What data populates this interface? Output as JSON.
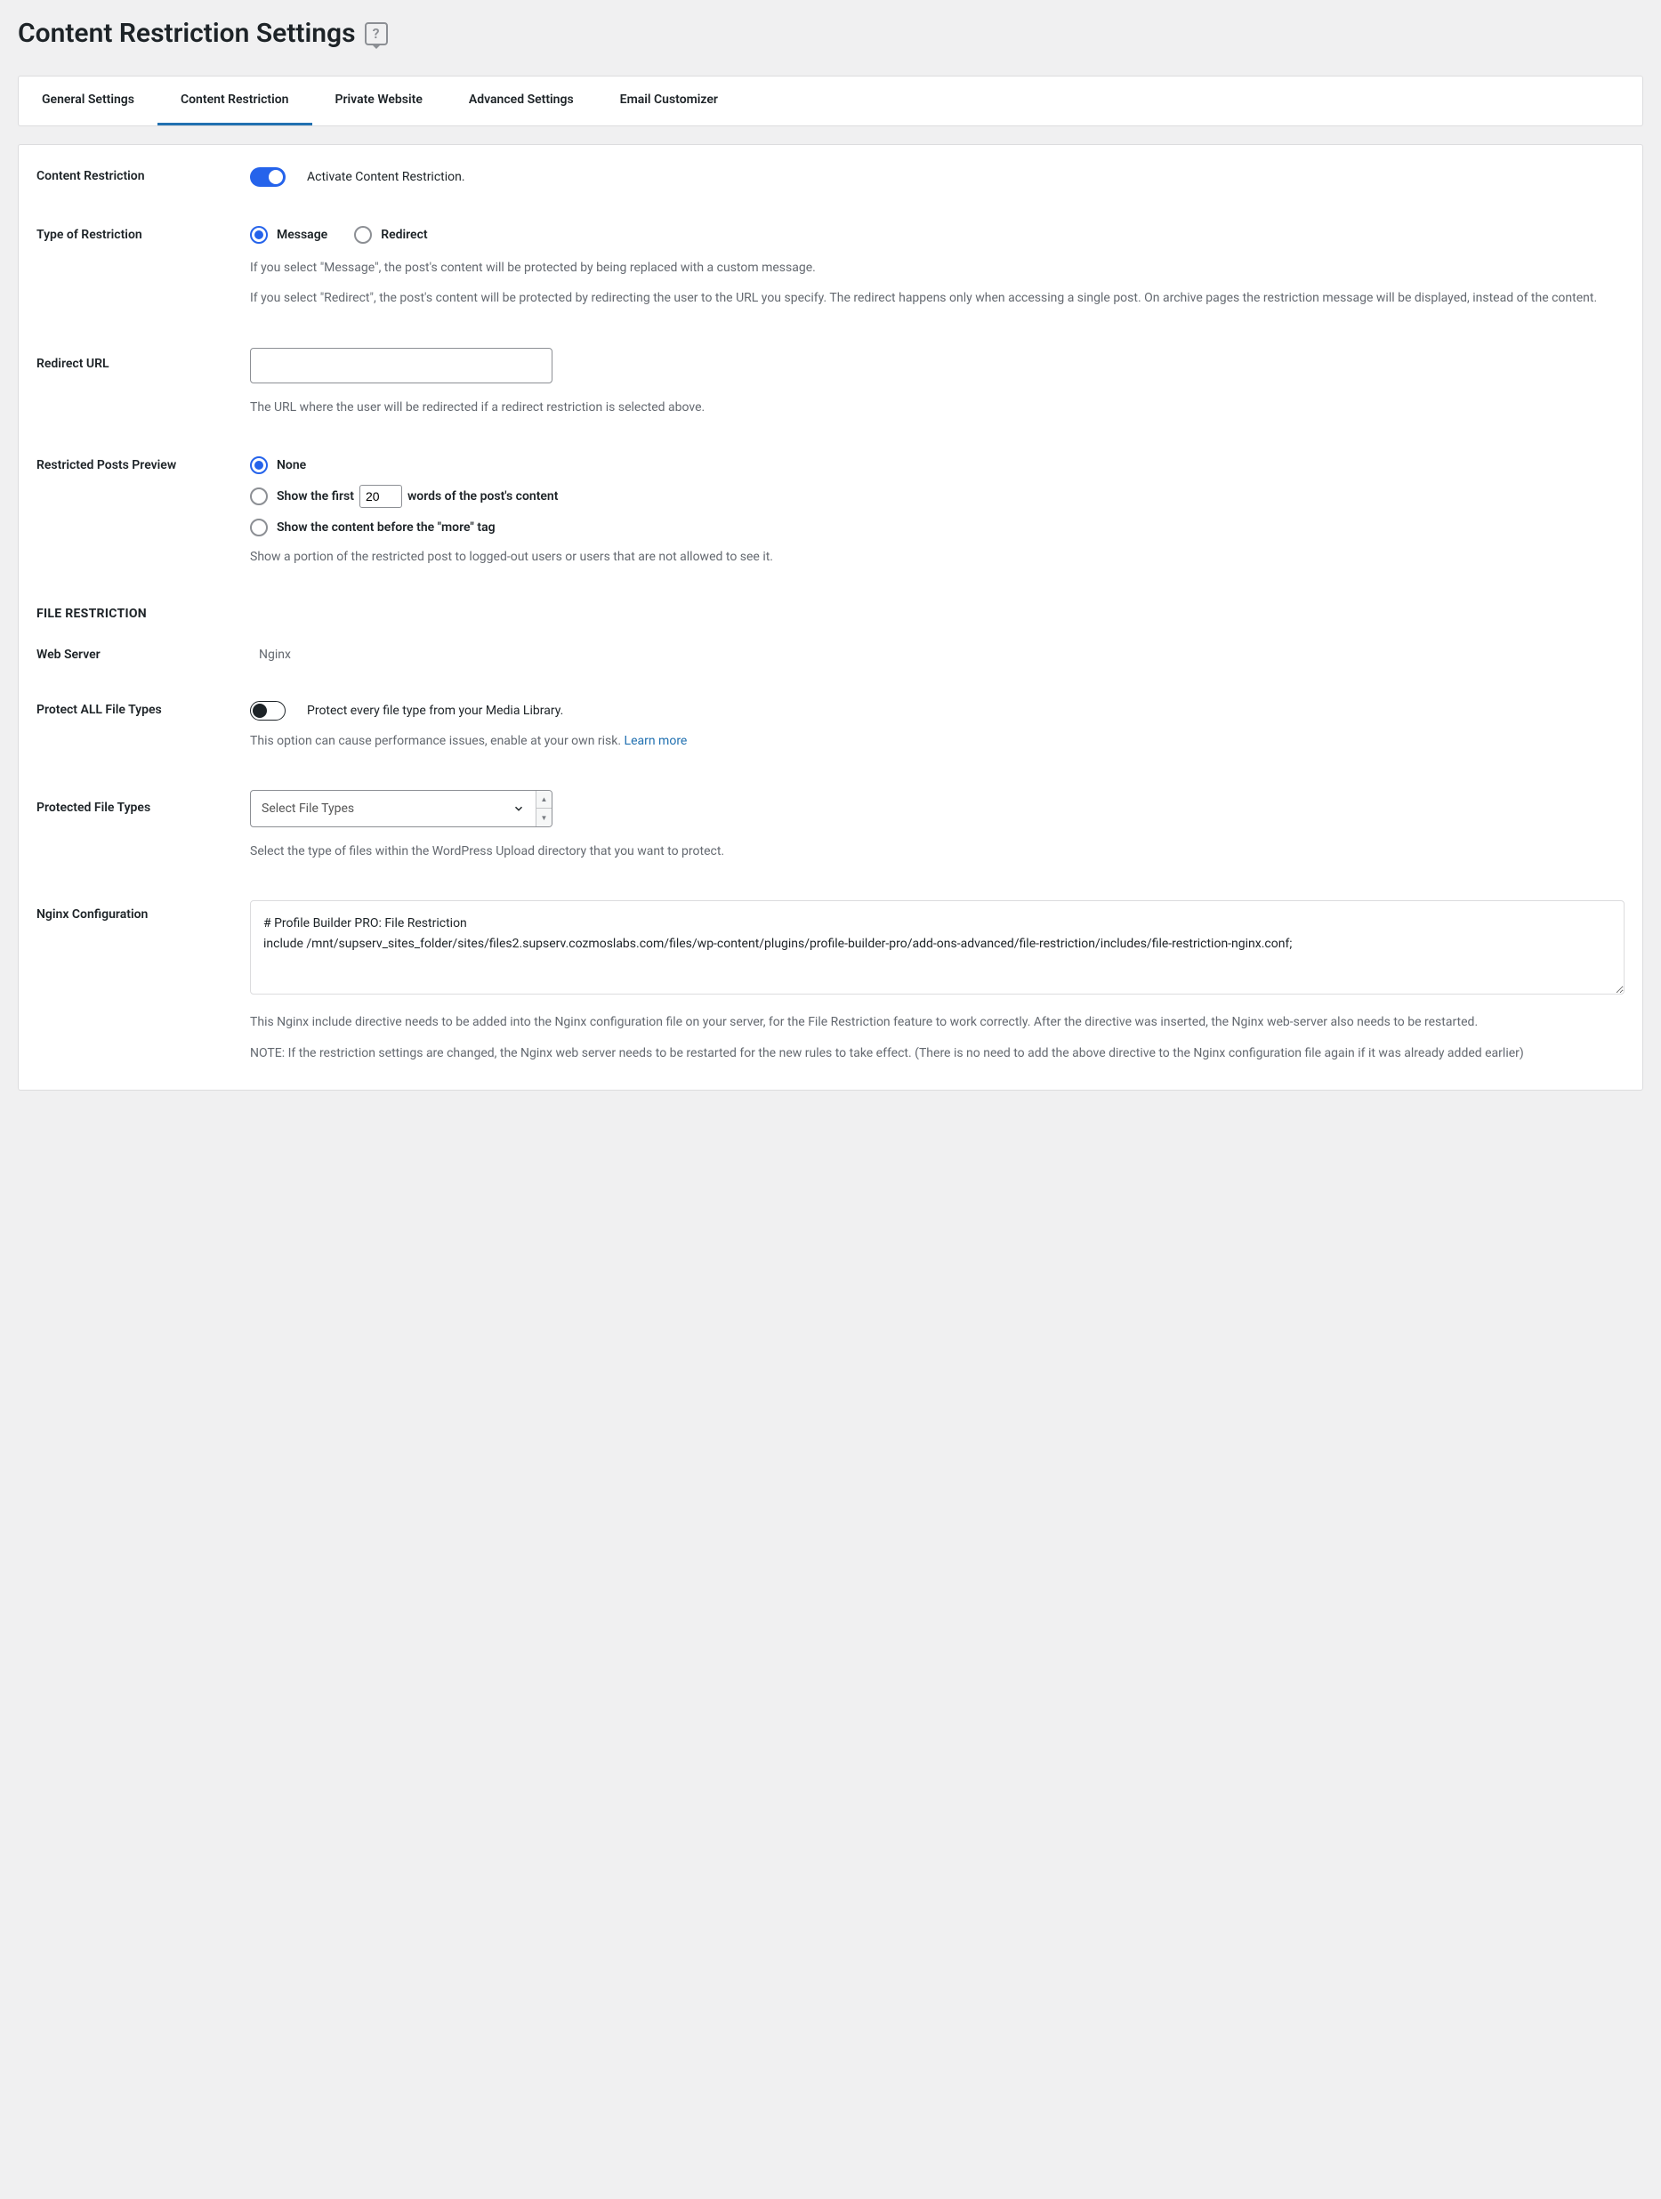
{
  "page": {
    "title": "Content Restriction Settings",
    "help_glyph": "?"
  },
  "tabs": [
    {
      "label": "General Settings",
      "active": false
    },
    {
      "label": "Content Restriction",
      "active": true
    },
    {
      "label": "Private Website",
      "active": false
    },
    {
      "label": "Advanced Settings",
      "active": false
    },
    {
      "label": "Email Customizer",
      "active": false
    }
  ],
  "content_restriction": {
    "label": "Content Restriction",
    "toggle_on": true,
    "toggle_label": "Activate Content Restriction."
  },
  "type_of_restriction": {
    "label": "Type of Restriction",
    "options": {
      "message": "Message",
      "redirect": "Redirect"
    },
    "selected": "message",
    "help1": "If you select \"Message\", the post's content will be protected by being replaced with a custom message.",
    "help2": "If you select \"Redirect\", the post's content will be protected by redirecting the user to the URL you specify. The redirect happens only when accessing a single post. On archive pages the restriction message will be displayed, instead of the content."
  },
  "redirect_url": {
    "label": "Redirect URL",
    "value": "",
    "help": "The URL where the user will be redirected if a redirect restriction is selected above."
  },
  "restricted_preview": {
    "label": "Restricted Posts Preview",
    "options": {
      "none": "None",
      "words_prefix": "Show the first",
      "words_suffix": "words of the post's content",
      "words_value": "20",
      "more_tag": "Show the content before the \"more\" tag"
    },
    "selected": "none",
    "help": "Show a portion of the restricted post to logged-out users or users that are not allowed to see it."
  },
  "file_restriction": {
    "heading": "FILE RESTRICTION"
  },
  "web_server": {
    "label": "Web Server",
    "value": "Nginx"
  },
  "protect_all": {
    "label": "Protect ALL File Types",
    "toggle_on": false,
    "toggle_label": "Protect every file type from your Media Library.",
    "help_text": "This option can cause performance issues, enable at your own risk. ",
    "learn_more": "Learn more"
  },
  "protected_types": {
    "label": "Protected File Types",
    "placeholder": "Select File Types",
    "help": "Select the type of files within the WordPress Upload directory that you want to protect."
  },
  "nginx_config": {
    "label": "Nginx Configuration",
    "value": "# Profile Builder PRO: File Restriction\ninclude /mnt/supserv_sites_folder/sites/files2.supserv.cozmoslabs.com/files/wp-content/plugins/profile-builder-pro/add-ons-advanced/file-restriction/includes/file-restriction-nginx.conf;",
    "help1": "This Nginx include directive needs to be added into the Nginx configuration file on your server, for the File Restriction feature to work correctly. After the directive was inserted, the Nginx web-server also needs to be restarted.",
    "help2": "NOTE: If the restriction settings are changed, the Nginx web server needs to be restarted for the new rules to take effect. (There is no need to add the above directive to the Nginx configuration file again if it was already added earlier)"
  }
}
